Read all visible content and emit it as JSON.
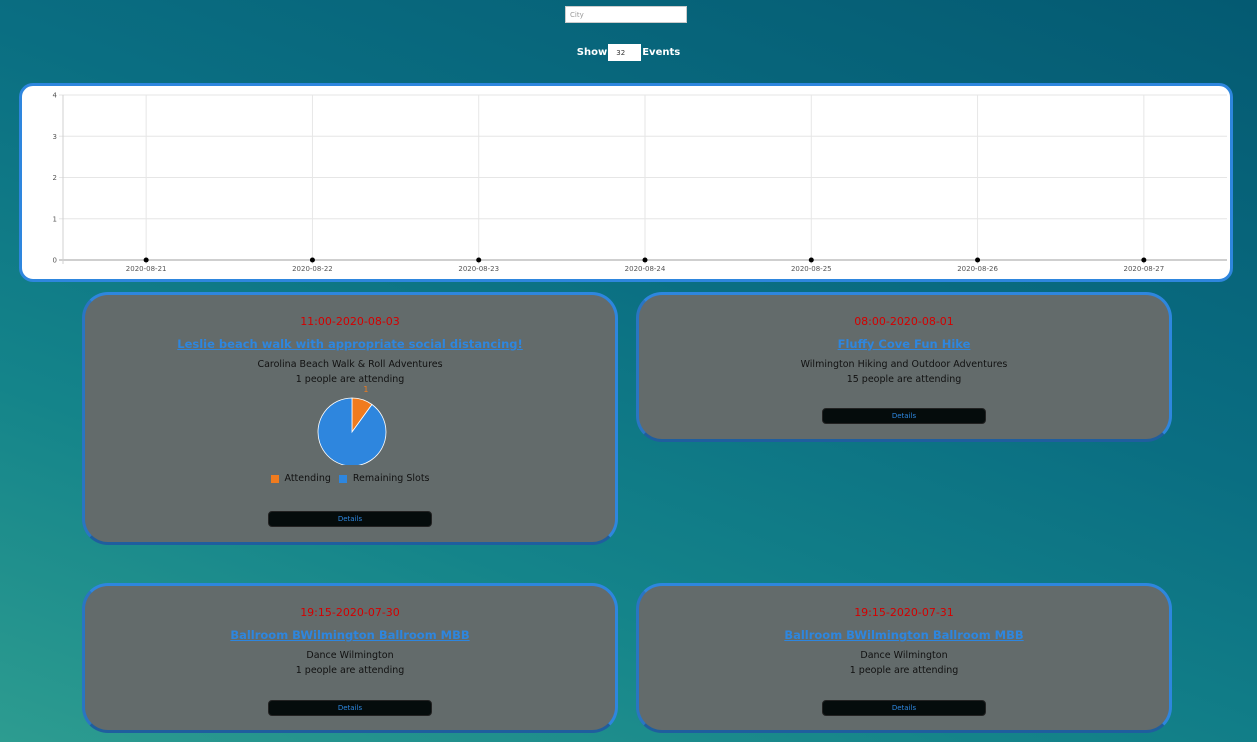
{
  "search": {
    "placeholder": "City"
  },
  "show": {
    "label_before": "Show",
    "count": "32",
    "label_after": "Events"
  },
  "chart_data": {
    "type": "scatter",
    "x": [
      "2020-08-21",
      "2020-08-22",
      "2020-08-23",
      "2020-08-24",
      "2020-08-25",
      "2020-08-26",
      "2020-08-27"
    ],
    "values": [
      0,
      0,
      0,
      0,
      0,
      0,
      0
    ],
    "y_ticks": [
      "0",
      "1",
      "2",
      "3",
      "4"
    ],
    "ylim": [
      0,
      4
    ],
    "grid": true,
    "point_color": "#000000"
  },
  "events": [
    {
      "time": "11:00-2020-08-03",
      "title": "Leslie beach walk with appropriate social distancing!",
      "organizer": "Carolina Beach Walk & Roll Adventures",
      "attending_text": "1 people are attending",
      "details_label": "Details",
      "pie": {
        "slices": [
          {
            "name": "Attending",
            "value": 1,
            "color": "#f07b1e"
          },
          {
            "name": "Remaining Slots",
            "value": 9,
            "color": "#2e86de"
          }
        ]
      }
    },
    {
      "time": "08:00-2020-08-01",
      "title": "Fluffy Cove Fun Hike",
      "organizer": "Wilmington Hiking and Outdoor Adventures",
      "attending_text": "15 people are attending",
      "details_label": "Details"
    },
    {
      "time": "19:15-2020-07-30",
      "title": "Ballroom BWilmington Ballroom MBB",
      "organizer": "Dance Wilmington",
      "attending_text": "1 people are attending",
      "details_label": "Details"
    },
    {
      "time": "19:15-2020-07-31",
      "title": "Ballroom BWilmington Ballroom MBB",
      "organizer": "Dance Wilmington",
      "attending_text": "1 people are attending",
      "details_label": "Details"
    }
  ]
}
